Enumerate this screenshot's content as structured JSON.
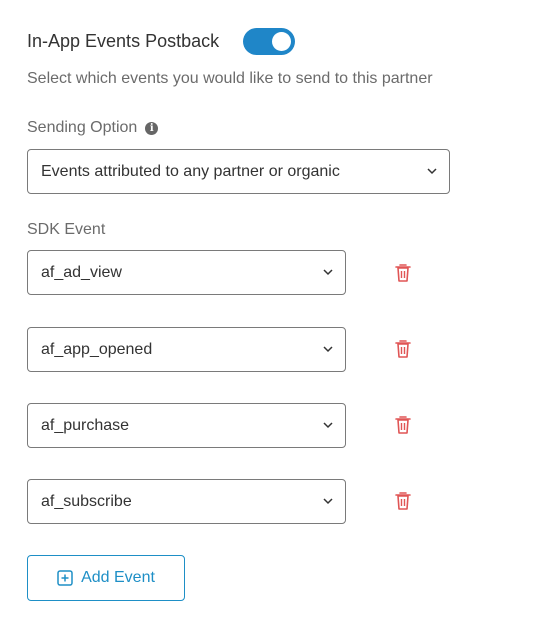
{
  "postback": {
    "title": "In-App Events Postback",
    "toggle_on": true,
    "subtitle": "Select which events you would like to send to this partner"
  },
  "sending_option": {
    "label": "Sending Option",
    "info_icon": "info-icon",
    "selected": "Events attributed to any partner or organic"
  },
  "sdk": {
    "label": "SDK Event",
    "events": [
      {
        "value": "af_ad_view"
      },
      {
        "value": "af_app_opened"
      },
      {
        "value": "af_purchase"
      },
      {
        "value": "af_subscribe"
      }
    ],
    "delete_icon": "trash-icon"
  },
  "add_event": {
    "label": "Add Event",
    "icon": "plus-square-icon"
  },
  "colors": {
    "accent": "#1e8fc6",
    "toggle": "#1f86c8",
    "delete": "#e05555"
  }
}
